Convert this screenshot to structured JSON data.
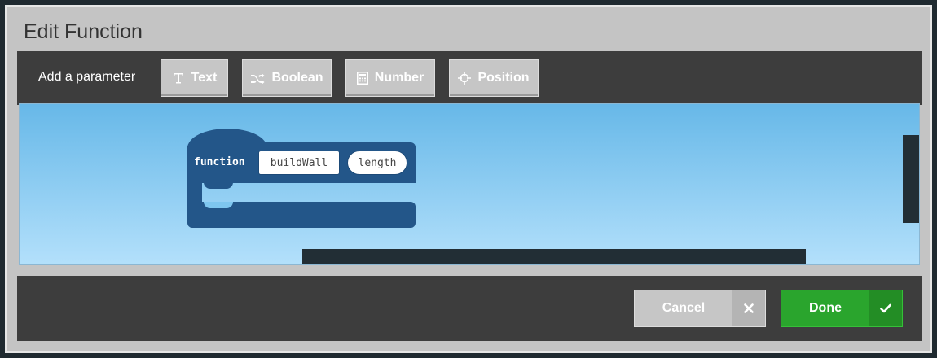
{
  "dialog": {
    "title": "Edit Function"
  },
  "toolbar": {
    "label": "Add a parameter",
    "buttons": [
      {
        "label": "Text",
        "icon": "text-icon"
      },
      {
        "label": "Boolean",
        "icon": "shuffle-icon"
      },
      {
        "label": "Number",
        "icon": "calculator-icon"
      },
      {
        "label": "Position",
        "icon": "crosshair-icon"
      }
    ]
  },
  "block": {
    "keyword": "function",
    "name": "buildWall",
    "parameter": "length",
    "color": "#235689"
  },
  "footer": {
    "cancel_label": "Cancel",
    "done_label": "Done"
  },
  "colors": {
    "done": "#2aa52d",
    "button": "#c6c6c6",
    "panel": "#3d3d3d"
  }
}
